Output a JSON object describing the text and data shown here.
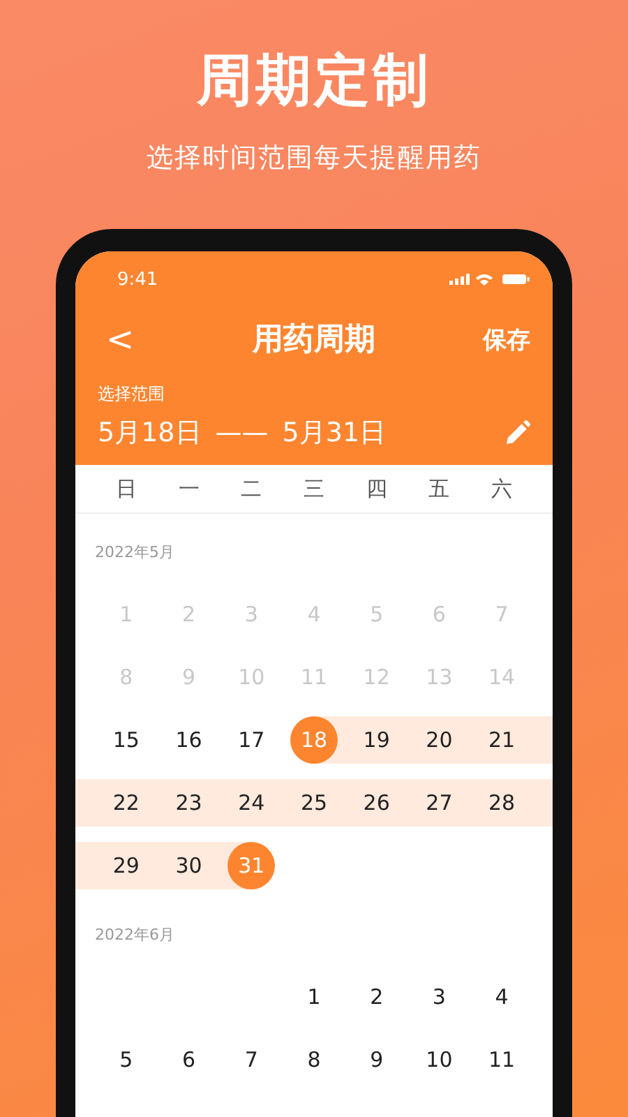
{
  "promo": {
    "title": "周期定制",
    "subtitle": "选择时间范围每天提醒用药"
  },
  "status_bar": {
    "time": "9:41"
  },
  "nav": {
    "back": "<",
    "title": "用药周期",
    "action": "保存"
  },
  "range": {
    "label": "选择范围",
    "start": "5月18日",
    "separator": "——",
    "end": "5月31日"
  },
  "weekdays": [
    "日",
    "一",
    "二",
    "三",
    "四",
    "五",
    "六"
  ],
  "months": [
    {
      "label": "2022年5月",
      "weeks": [
        [
          {
            "label": "1",
            "kind": "past"
          },
          {
            "label": "2",
            "kind": "past"
          },
          {
            "label": "3",
            "kind": "past"
          },
          {
            "label": "4",
            "kind": "past"
          },
          {
            "label": "5",
            "kind": "past"
          },
          {
            "label": "6",
            "kind": "past"
          },
          {
            "label": "7",
            "kind": "past"
          }
        ],
        [
          {
            "label": "8",
            "kind": "past"
          },
          {
            "label": "9",
            "kind": "past"
          },
          {
            "label": "10",
            "kind": "past"
          },
          {
            "label": "11",
            "kind": "past"
          },
          {
            "label": "12",
            "kind": "past"
          },
          {
            "label": "13",
            "kind": "past"
          },
          {
            "label": "14",
            "kind": "past"
          }
        ],
        [
          {
            "label": "15",
            "kind": "normal"
          },
          {
            "label": "16",
            "kind": "normal"
          },
          {
            "label": "17",
            "kind": "normal"
          },
          {
            "label": "18",
            "kind": "start"
          },
          {
            "label": "19",
            "kind": "range"
          },
          {
            "label": "20",
            "kind": "range"
          },
          {
            "label": "21",
            "kind": "range"
          }
        ],
        [
          {
            "label": "22",
            "kind": "range"
          },
          {
            "label": "23",
            "kind": "range"
          },
          {
            "label": "24",
            "kind": "range"
          },
          {
            "label": "25",
            "kind": "range"
          },
          {
            "label": "26",
            "kind": "range"
          },
          {
            "label": "27",
            "kind": "range"
          },
          {
            "label": "28",
            "kind": "range"
          }
        ],
        [
          {
            "label": "29",
            "kind": "range"
          },
          {
            "label": "30",
            "kind": "range"
          },
          {
            "label": "31",
            "kind": "end"
          },
          {
            "kind": "blank"
          },
          {
            "kind": "blank"
          },
          {
            "kind": "blank"
          },
          {
            "kind": "blank"
          }
        ]
      ]
    },
    {
      "label": "2022年6月",
      "weeks": [
        [
          {
            "kind": "blank"
          },
          {
            "kind": "blank"
          },
          {
            "kind": "blank"
          },
          {
            "label": "1",
            "kind": "normal"
          },
          {
            "label": "2",
            "kind": "normal"
          },
          {
            "label": "3",
            "kind": "normal"
          },
          {
            "label": "4",
            "kind": "normal"
          }
        ],
        [
          {
            "label": "5",
            "kind": "normal"
          },
          {
            "label": "6",
            "kind": "normal"
          },
          {
            "label": "7",
            "kind": "normal"
          },
          {
            "label": "8",
            "kind": "normal"
          },
          {
            "label": "9",
            "kind": "normal"
          },
          {
            "label": "10",
            "kind": "normal"
          },
          {
            "label": "11",
            "kind": "normal"
          }
        ]
      ]
    }
  ]
}
